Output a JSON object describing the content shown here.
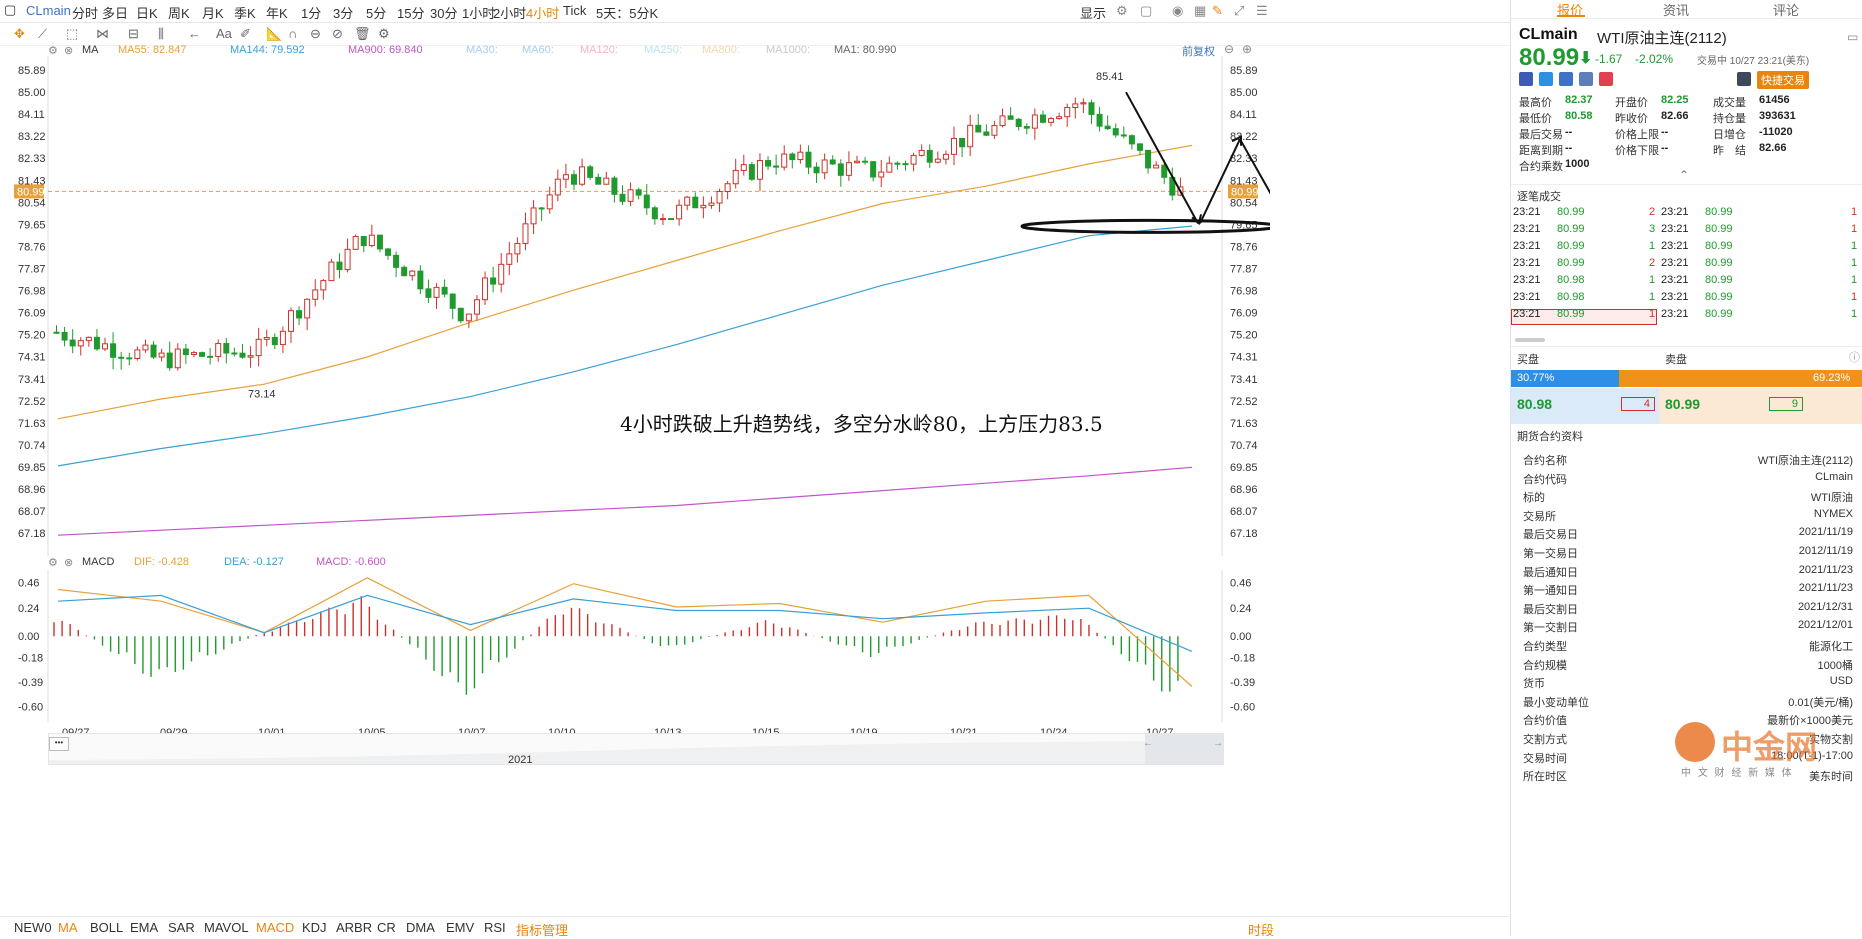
{
  "topbar": {
    "symbol": "CLmain",
    "periods": [
      "分时",
      "多日",
      "日K",
      "周K",
      "月K",
      "季K",
      "年K",
      "1分",
      "3分",
      "5分",
      "15分",
      "30分",
      "1小时",
      "2小时",
      "4小时",
      "Tick",
      "5天：5分K"
    ],
    "active_period": "4小时",
    "display_label": "显示"
  },
  "toolbar": {
    "text_tool": "Aa"
  },
  "ma_strip": {
    "title": "MA",
    "items": [
      {
        "label": "MA55: 82.847",
        "color": "#e8a13a"
      },
      {
        "label": "MA144: 79.592",
        "color": "#3aa0d6"
      },
      {
        "label": "MA900: 69.840",
        "color": "#c255c8"
      },
      {
        "label": "MA30:",
        "color": "#a9cdee"
      },
      {
        "label": "MA60:",
        "color": "#a9cdee"
      },
      {
        "label": "MA120:",
        "color": "#f2b6bd"
      },
      {
        "label": "MA250:",
        "color": "#bde3f3"
      },
      {
        "label": "MA800:",
        "color": "#f5d8a9"
      },
      {
        "label": "MA1000:",
        "color": "#c9c9c9"
      },
      {
        "label": "MA1: 80.990",
        "color": "#666666"
      }
    ],
    "restore_label": "前复权"
  },
  "macd_strip": {
    "title": "MACD",
    "items": [
      {
        "label": "DIF: -0.428",
        "color": "#e8a13a"
      },
      {
        "label": "DEA: -0.127",
        "color": "#3aa0d6"
      },
      {
        "label": "MACD: -0.600",
        "color": "#c255c8"
      }
    ]
  },
  "price_axis": [
    "85.89",
    "85.00",
    "84.11",
    "83.22",
    "82.33",
    "81.43",
    "80.54",
    "79.65",
    "78.76",
    "77.87",
    "76.98",
    "76.09",
    "75.20",
    "74.31",
    "73.41",
    "72.52",
    "71.63",
    "70.74",
    "69.85",
    "68.96",
    "68.07",
    "67.18"
  ],
  "current_price_tag": "80.99",
  "macd_axis": [
    "0.46",
    "0.24",
    "0.00",
    "-0.18",
    "-0.39",
    "-0.60"
  ],
  "date_axis": [
    "09/27",
    "09/29",
    "10/01",
    "10/05",
    "10/07",
    "10/10",
    "10/13",
    "10/15",
    "10/19",
    "10/21",
    "10/24",
    "10/27"
  ],
  "annotations": {
    "high": "85.41",
    "low": "73.14",
    "note": "4小时跌破上升趋势线，多空分水岭80，上方压力83.5"
  },
  "navigator": {
    "year": "2021",
    "more": "•••"
  },
  "chart_data": {
    "type": "line",
    "title": "",
    "x": [
      "09/27",
      "09/29",
      "10/01",
      "10/05",
      "10/07",
      "10/10",
      "10/13",
      "10/15",
      "10/19",
      "10/21",
      "10/24",
      "10/27"
    ],
    "series": [
      {
        "name": "MA55",
        "values": [
          71.8,
          72.6,
          73.2,
          74.3,
          75.7,
          77.0,
          78.2,
          79.4,
          80.5,
          81.2,
          82.1,
          82.85
        ]
      },
      {
        "name": "MA144",
        "values": [
          69.9,
          70.6,
          71.2,
          71.9,
          72.7,
          73.7,
          74.8,
          76.0,
          77.2,
          78.2,
          79.2,
          79.59
        ]
      },
      {
        "name": "MA900",
        "values": [
          67.1,
          67.3,
          67.5,
          67.7,
          67.9,
          68.1,
          68.3,
          68.6,
          68.9,
          69.2,
          69.5,
          69.84
        ]
      },
      {
        "name": "Close",
        "values": [
          75.3,
          74.2,
          74.6,
          79.2,
          76.0,
          81.8,
          80.0,
          82.3,
          81.8,
          83.3,
          84.6,
          80.99
        ]
      }
    ],
    "ylim": [
      66.5,
      86.3
    ],
    "macd": {
      "ylim": [
        -0.7,
        0.55
      ],
      "DIF": [
        0.4,
        0.3,
        0.03,
        0.5,
        0.05,
        0.45,
        0.25,
        0.28,
        0.12,
        0.3,
        0.35,
        -0.43
      ],
      "DEA": [
        0.3,
        0.35,
        0.03,
        0.35,
        0.1,
        0.32,
        0.22,
        0.22,
        0.15,
        0.2,
        0.24,
        -0.13
      ],
      "MACD": [
        0.2,
        -0.4,
        0.02,
        0.35,
        -0.55,
        0.3,
        -0.12,
        0.15,
        -0.18,
        0.12,
        0.2,
        -0.6
      ]
    }
  },
  "quote": {
    "tabs": [
      "报价",
      "资讯",
      "评论"
    ],
    "active_tab": "报价",
    "symbol": "CLmain",
    "name": "WTI原油主连(2112)",
    "price": "80.99",
    "change": "-1.67",
    "change_pct": "-2.02%",
    "status": "交易中 10/27 23:21(美东)",
    "quick_trade": "快捷交易",
    "stats": [
      [
        {
          "k": "最高价",
          "v": "82.37",
          "c": "green"
        },
        {
          "k": "开盘价",
          "v": "82.25",
          "c": "green"
        },
        {
          "k": "成交量",
          "v": "61456",
          "c": "dark"
        }
      ],
      [
        {
          "k": "最低价",
          "v": "80.58",
          "c": "green"
        },
        {
          "k": "昨收价",
          "v": "82.66",
          "c": "dark"
        },
        {
          "k": "持仓量",
          "v": "393631",
          "c": "dark"
        }
      ],
      [
        {
          "k": "最后交易",
          "v": "--",
          "c": "dark"
        },
        {
          "k": "价格上限",
          "v": "--",
          "c": "dark"
        },
        {
          "k": "日增仓",
          "v": "-11020",
          "c": "dark"
        }
      ],
      [
        {
          "k": "距离到期",
          "v": "--",
          "c": "dark"
        },
        {
          "k": "价格下限",
          "v": "--",
          "c": "dark"
        },
        {
          "k": "昨　结",
          "v": "82.66",
          "c": "dark"
        }
      ],
      [
        {
          "k": "合约乘数",
          "v": "1000",
          "c": "dark"
        }
      ]
    ],
    "ticks_title": "逐笔成交",
    "ticks_left": [
      {
        "t": "23:21",
        "p": "80.99",
        "q": "2",
        "qc": "red"
      },
      {
        "t": "23:21",
        "p": "80.99",
        "q": "3",
        "qc": "green"
      },
      {
        "t": "23:21",
        "p": "80.99",
        "q": "1",
        "qc": "green"
      },
      {
        "t": "23:21",
        "p": "80.99",
        "q": "2",
        "qc": "red"
      },
      {
        "t": "23:21",
        "p": "80.98",
        "q": "1",
        "qc": "green"
      },
      {
        "t": "23:21",
        "p": "80.98",
        "q": "1",
        "qc": "green"
      },
      {
        "t": "23:21",
        "p": "80.99",
        "q": "1",
        "qc": "red"
      }
    ],
    "ticks_right": [
      {
        "t": "23:21",
        "p": "80.99",
        "q": "1",
        "qc": "red"
      },
      {
        "t": "23:21",
        "p": "80.99",
        "q": "1",
        "qc": "red"
      },
      {
        "t": "23:21",
        "p": "80.99",
        "q": "1",
        "qc": "green"
      },
      {
        "t": "23:21",
        "p": "80.99",
        "q": "1",
        "qc": "green"
      },
      {
        "t": "23:21",
        "p": "80.99",
        "q": "1",
        "qc": "green"
      },
      {
        "t": "23:21",
        "p": "80.99",
        "q": "1",
        "qc": "red"
      },
      {
        "t": "23:21",
        "p": "80.99",
        "q": "1",
        "qc": "green"
      }
    ],
    "orderbook": {
      "bid_label": "买盘",
      "ask_label": "卖盘",
      "bid_pct": "30.77%",
      "ask_pct": "69.23%",
      "bid_ratio": 0.3077,
      "bid_price": "80.98",
      "bid_qty": "4",
      "ask_price": "80.99",
      "ask_qty": "9"
    },
    "contract_title": "期货合约资料",
    "contract": [
      {
        "k": "合约名称",
        "v": "WTI原油主连(2112)"
      },
      {
        "k": "合约代码",
        "v": "CLmain"
      },
      {
        "k": "标的",
        "v": "WTI原油"
      },
      {
        "k": "交易所",
        "v": "NYMEX"
      },
      {
        "k": "最后交易日",
        "v": "2021/11/19"
      },
      {
        "k": "第一交易日",
        "v": "2012/11/19"
      },
      {
        "k": "最后通知日",
        "v": "2021/11/23"
      },
      {
        "k": "第一通知日",
        "v": "2021/11/23"
      },
      {
        "k": "最后交割日",
        "v": "2021/12/31"
      },
      {
        "k": "第一交割日",
        "v": "2021/12/01"
      },
      {
        "k": "合约类型",
        "v": "能源化工"
      },
      {
        "k": "合约规模",
        "v": "1000桶"
      },
      {
        "k": "货币",
        "v": "USD"
      },
      {
        "k": "最小变动单位",
        "v": "0.01(美元/桶)"
      },
      {
        "k": "合约价值",
        "v": "最新价×1000美元"
      },
      {
        "k": "交割方式",
        "v": "实物交割"
      },
      {
        "k": "交易时间",
        "v": "18:00(T-1)-17:00"
      },
      {
        "k": "所在时区",
        "v": "美东时间"
      }
    ],
    "watermark": "中金网",
    "watermark_sub": "中 文 财 经 新 媒 体"
  },
  "bottombar": {
    "items": [
      "NEW0",
      "MA",
      "BOLL",
      "EMA",
      "SAR",
      "MAVOL",
      "MACD",
      "KDJ",
      "ARBR",
      "CR",
      "DMA",
      "EMV",
      "RSI",
      "指标管理"
    ],
    "active": [
      "MA",
      "MACD",
      "指标管理"
    ],
    "right_label": "时段"
  },
  "colors": {
    "up": "#d0302a",
    "down": "#1f9a2e",
    "accent": "#e8850f",
    "ma55": "#e8a13a",
    "ma144": "#3aa0d6",
    "ma900": "#c255c8"
  }
}
